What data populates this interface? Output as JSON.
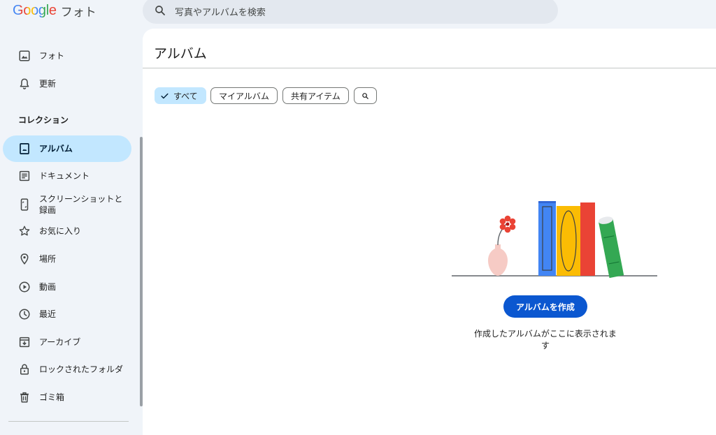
{
  "header": {
    "logo_text": "Google",
    "app_name": "フォト",
    "search_placeholder": "写真やアルバムを検索"
  },
  "sidebar": {
    "items": [
      {
        "label": "フォト",
        "icon": "photo-icon"
      },
      {
        "label": "更新",
        "icon": "bell-icon"
      }
    ],
    "collections_title": "コレクション",
    "collection_items": [
      {
        "label": "アルバム",
        "icon": "album-icon",
        "active": true
      },
      {
        "label": "ドキュメント",
        "icon": "document-icon"
      },
      {
        "label": "スクリーンショットと録画",
        "label_line1": "スクリーンショットと",
        "label_line2": "録画",
        "icon": "screenshot-icon"
      },
      {
        "label": "お気に入り",
        "icon": "star-icon"
      },
      {
        "label": "場所",
        "icon": "location-pin-icon"
      },
      {
        "label": "動画",
        "icon": "play-circle-icon"
      },
      {
        "label": "最近",
        "icon": "clock-icon"
      },
      {
        "label": "アーカイブ",
        "icon": "archive-icon"
      },
      {
        "label": "ロックされたフォルダ",
        "icon": "lock-icon"
      },
      {
        "label": "ゴミ箱",
        "icon": "trash-icon"
      }
    ]
  },
  "main": {
    "title": "アルバム",
    "filters": [
      {
        "label": "すべて",
        "selected": true
      },
      {
        "label": "マイアルバム",
        "selected": false
      },
      {
        "label": "共有アイテム",
        "selected": false
      }
    ],
    "filter_search_icon": "search-icon",
    "empty_state": {
      "button_label": "アルバムを作成",
      "message": "作成したアルバムがここに表示されます"
    }
  },
  "colors": {
    "background": "#f0f4f9",
    "active_nav": "#c2e7ff",
    "primary_button": "#0b57d0",
    "book_blue": "#4285f4",
    "book_yellow": "#fbbc04",
    "book_red": "#ea4335",
    "book_green": "#34a853",
    "flower": "#ea4335",
    "vase": "#f6cbc5"
  }
}
